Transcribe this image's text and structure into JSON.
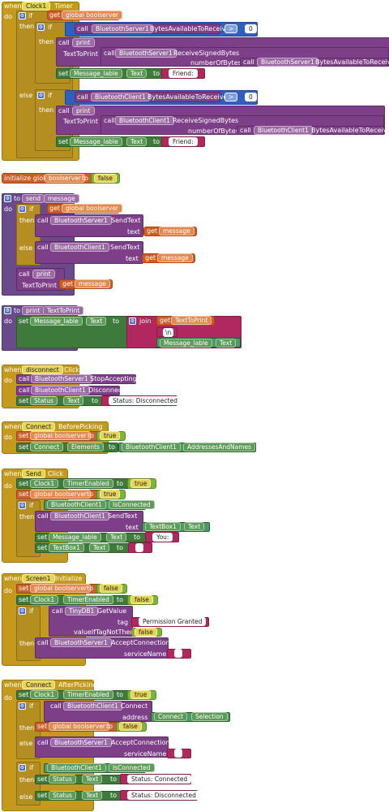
{
  "kw": {
    "when": "when",
    "do": "do",
    "then": "then",
    "else": "else",
    "if": "if",
    "set": "set",
    "get": "get",
    "call": "call",
    "to": "to",
    "initialize_global": "initialize global",
    "join": "join"
  },
  "b1": {
    "component": "Clock1",
    "event": "Timer",
    "global": "global boolserver",
    "server": "BluetoothServer1",
    "bytes_avail": "BytesAvailableToReceive",
    "op": ">",
    "zero": "0",
    "print": "print",
    "texttoprint": "TextToPrint",
    "receive": "ReceiveSignedBytes",
    "numbytes": "numberOfBytes",
    "label": "Message_lable",
    "text_prop": "Text",
    "friend": "Friend: ",
    "client": "BluetoothClient1"
  },
  "b2": {
    "name": "boolserver",
    "value": "false"
  },
  "b3": {
    "proc": "send",
    "param": "message",
    "server": "BluetoothServer1",
    "client": "BluetoothClient1",
    "method": "SendText",
    "text": "text",
    "get_msg": "message",
    "print": "print",
    "ttp": "TextToPrint",
    "global": "global boolserver"
  },
  "b4": {
    "proc": "print",
    "param": "TextToPrint",
    "label": "Message_lable",
    "prop": "Text",
    "get": "TextToPrint",
    "newline": "\\n"
  },
  "b5": {
    "component": "disconnect",
    "event": "Click",
    "server": "BluetoothServer1",
    "stop": "StopAccepting",
    "client": "BluetoothClient1",
    "disc": "Disconnect",
    "status": "Status",
    "prop": "Text",
    "value": "Status: Disconnected"
  },
  "b6": {
    "component": "Connect",
    "event": "BeforePicking",
    "global": "global boolserver",
    "true": "true",
    "comp": "Connect",
    "elements": "Elements",
    "client": "BluetoothClient1",
    "addr": "AddressesAndNames"
  },
  "b7": {
    "component": "Send",
    "event": "Click",
    "clock": "Clock1",
    "timer": "TimerEnabled",
    "true": "true",
    "global": "global boolserver",
    "client": "BluetoothClient1",
    "connected": "IsConnected",
    "sendtext": "SendText",
    "text": "text",
    "tb": "TextBox1",
    "prop": "Text",
    "label": "Message_lable",
    "you": "You: "
  },
  "b8": {
    "component": "Screen1",
    "event": "Initialize",
    "global": "global boolserver",
    "false": "false",
    "clock": "Clock1",
    "timer": "TimerEnabled",
    "db": "TinyDB1",
    "getvalue": "GetValue",
    "tag": "tag",
    "tagval": "Permission Granted",
    "ifnot": "valueIfTagNotThere",
    "server": "BluetoothServer1",
    "accept": "AcceptConnection",
    "svc": "serviceName"
  },
  "b9": {
    "component": "Connect",
    "event": "AfterPicking",
    "clock": "Clock1",
    "timer": "TimerEnabled",
    "true": "true",
    "client": "BluetoothClient1",
    "connect": "Connect",
    "address": "address",
    "selection": "Selection",
    "global": "global boolserver",
    "false": "false",
    "server": "BluetoothServer1",
    "accept": "AcceptConnection",
    "svc": "serviceName",
    "connected": "IsConnected",
    "status": "Status",
    "prop": "Text",
    "s_conn": "Status: Connected",
    "s_disc": "Status: Disconnected"
  }
}
